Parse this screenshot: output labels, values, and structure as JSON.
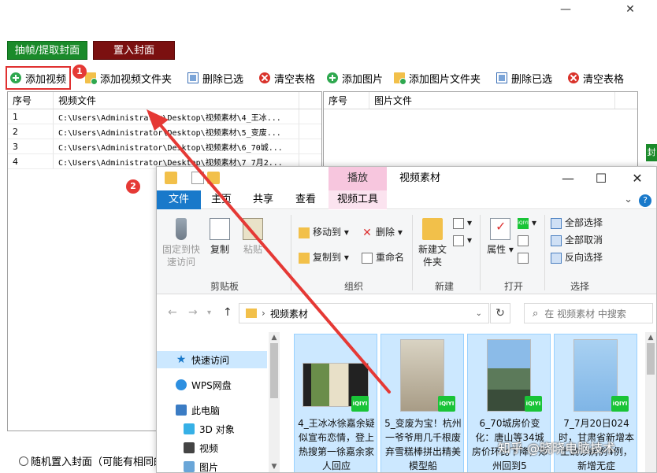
{
  "app": {
    "window_controls": {
      "minimize": "—",
      "close": "✕"
    },
    "mode_buttons": [
      "抽帧/提取封面",
      "置入封面"
    ],
    "toolbar": [
      {
        "label": "添加视频",
        "icon": "add-icon"
      },
      {
        "label": "添加视频文件夹",
        "icon": "folder-add-icon"
      },
      {
        "label": "删除已选",
        "icon": "delete-selected-icon"
      },
      {
        "label": "清空表格",
        "icon": "clear-icon"
      },
      {
        "label": "添加图片",
        "icon": "add-icon"
      },
      {
        "label": "添加图片文件夹",
        "icon": "folder-add-icon"
      },
      {
        "label": "删除已选",
        "icon": "delete-selected-icon"
      },
      {
        "label": "清空表格",
        "icon": "clear-icon"
      }
    ],
    "video_table": {
      "headers": [
        "序号",
        "视频文件"
      ],
      "rows": [
        [
          "1",
          "C:\\Users\\Administrator\\Desktop\\视频素材\\4_王冰..."
        ],
        [
          "2",
          "C:\\Users\\Administrator\\Desktop\\视频素材\\5_变废..."
        ],
        [
          "3",
          "C:\\Users\\Administrator\\Desktop\\视频素材\\6_70城..."
        ],
        [
          "4",
          "C:\\Users\\Administrator\\Desktop\\视频素材\\7_7月2..."
        ]
      ]
    },
    "image_table": {
      "headers": [
        "序号",
        "图片文件"
      ]
    },
    "random_option": "随机置入封面（可能有相同的"
  },
  "explorer": {
    "play_tab": "播放",
    "title": "视频素材",
    "window_controls": {
      "minimize": "—",
      "maximize": "☐",
      "close": "✕"
    },
    "ribbon_tabs": [
      "文件",
      "主页",
      "共享",
      "查看",
      "视频工具"
    ],
    "help": "?",
    "clipboard": {
      "pin": "固定到快速访问",
      "copy": "复制",
      "paste": "粘贴",
      "label": "剪贴板"
    },
    "organize": {
      "move_to": "移动到",
      "copy_to": "复制到",
      "delete": "删除",
      "rename": "重命名",
      "label": "组织"
    },
    "new": {
      "new_folder": "新建文件夹",
      "label": "新建"
    },
    "open": {
      "properties": "属性",
      "label": "打开"
    },
    "select": {
      "select_all": "全部选择",
      "select_none": "全部取消",
      "invert": "反向选择",
      "label": "选择"
    },
    "address": "视频素材",
    "search_placeholder": "在 视频素材 中搜索",
    "nav": [
      "快速访问",
      "WPS网盘",
      "此电脑",
      "3D 对象",
      "视频",
      "图片"
    ],
    "files": [
      "4_王冰冰徐嘉余疑似宣布恋情，登上热搜第一徐嘉余家人回应",
      "5_变废为宝！杭州一爷爷用几千根废弃雪糕棒拼出精美模型船",
      "6_70城房价变化：唐山等34城房价环比下降，郑州回到5",
      "7_7月20日024时，甘肃省新增本土确诊病例4例，新增无症"
    ],
    "thumb_badge": "iQIYI"
  },
  "annotations": {
    "badge1": "1",
    "badge2": "2"
  },
  "watermark": "知乎 @晓晓电脑技术",
  "side_strip": "封"
}
